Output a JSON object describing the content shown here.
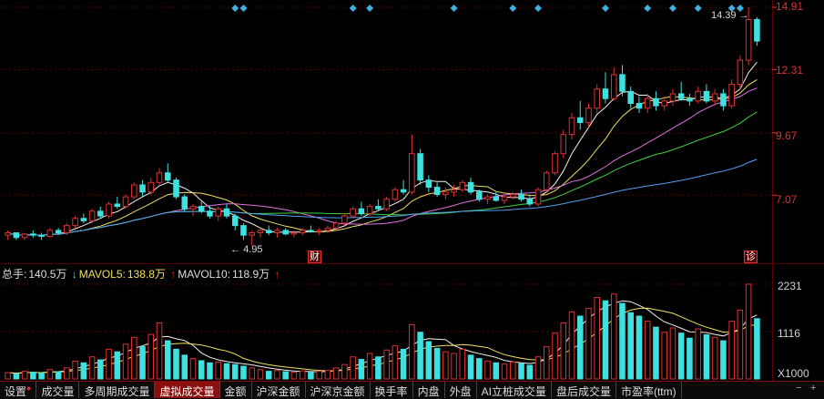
{
  "price_axis": {
    "labels": [
      "14.91",
      "12.31",
      "9.67",
      "7.07"
    ]
  },
  "volume_axis": {
    "labels": [
      "2231",
      "1116",
      "X1000"
    ]
  },
  "annotations": {
    "high": "14.39",
    "low": "4.95",
    "event_cai": "财",
    "event_zhen": "诊"
  },
  "indicators": {
    "total_label": "总手:",
    "total_value": "140.5万",
    "mavol5_label": "MAVOL5:",
    "mavol5_value": "138.8万",
    "mavol10_label": "MAVOL10:",
    "mavol10_value": "118.9万"
  },
  "tabs": [
    {
      "label": "设置",
      "active": false,
      "dot": true
    },
    {
      "label": "成交量",
      "active": false
    },
    {
      "label": "多周期成交量",
      "active": false
    },
    {
      "label": "虚拟成交量",
      "active": true
    },
    {
      "label": "金额",
      "active": false
    },
    {
      "label": "沪深金额",
      "active": false
    },
    {
      "label": "沪深京金额",
      "active": false
    },
    {
      "label": "换手率",
      "active": false
    },
    {
      "label": "内盘",
      "active": false
    },
    {
      "label": "外盘",
      "active": false
    },
    {
      "label": "AI立桩成交量",
      "active": false
    },
    {
      "label": "盘后成交量",
      "active": false
    },
    {
      "label": "市盈率(ttm)",
      "active": false
    }
  ],
  "controls": {
    "minus": "−",
    "plus": "+"
  },
  "colors": {
    "up": "#e03030",
    "down": "#3fe0e0",
    "ma_white": "#f0f0f0",
    "ma_yellow": "#f0e060",
    "ma_pink": "#e070e0",
    "ma_green": "#40d040",
    "ma_blue": "#50a0f0",
    "grid": "#5a0000"
  },
  "chart_data": {
    "type": "candlestick",
    "price_range": [
      4.95,
      14.91
    ],
    "volume_range": [
      0,
      2231
    ],
    "volume_unit": "X1000",
    "candles": [
      [
        5.4,
        5.6,
        5.2,
        5.5
      ],
      [
        5.5,
        5.5,
        5.2,
        5.3
      ],
      [
        5.3,
        5.5,
        5.2,
        5.45
      ],
      [
        5.45,
        5.6,
        5.3,
        5.4
      ],
      [
        5.4,
        5.5,
        5.2,
        5.35
      ],
      [
        5.35,
        5.7,
        5.3,
        5.6
      ],
      [
        5.6,
        5.7,
        5.4,
        5.5
      ],
      [
        5.5,
        5.9,
        5.4,
        5.8
      ],
      [
        5.8,
        6.2,
        5.7,
        6.1
      ],
      [
        6.1,
        6.3,
        5.9,
        6.0
      ],
      [
        6.0,
        6.5,
        5.9,
        6.4
      ],
      [
        6.4,
        6.6,
        6.1,
        6.2
      ],
      [
        6.2,
        6.8,
        6.1,
        6.7
      ],
      [
        6.7,
        7.0,
        6.5,
        6.6
      ],
      [
        6.6,
        7.1,
        6.5,
        7.0
      ],
      [
        7.0,
        7.6,
        6.9,
        7.5
      ],
      [
        7.5,
        7.7,
        7.0,
        7.2
      ],
      [
        7.2,
        7.8,
        7.1,
        7.6
      ],
      [
        7.6,
        8.2,
        7.5,
        8.0
      ],
      [
        8.0,
        8.4,
        7.6,
        7.7
      ],
      [
        7.7,
        7.8,
        6.9,
        7.0
      ],
      [
        7.0,
        7.1,
        6.4,
        6.5
      ],
      [
        6.5,
        6.7,
        6.2,
        6.6
      ],
      [
        6.6,
        6.8,
        6.3,
        6.4
      ],
      [
        6.4,
        6.6,
        6.1,
        6.2
      ],
      [
        6.2,
        6.6,
        6.0,
        6.5
      ],
      [
        6.5,
        6.7,
        6.1,
        6.2
      ],
      [
        6.2,
        6.3,
        5.6,
        5.8
      ],
      [
        5.8,
        5.9,
        5.2,
        5.4
      ],
      [
        5.4,
        5.6,
        4.95,
        5.5
      ],
      [
        5.5,
        5.7,
        5.3,
        5.6
      ],
      [
        5.6,
        5.8,
        5.4,
        5.5
      ],
      [
        5.5,
        5.7,
        5.3,
        5.6
      ],
      [
        5.6,
        5.7,
        5.4,
        5.45
      ],
      [
        5.45,
        5.6,
        5.3,
        5.5
      ],
      [
        5.5,
        5.7,
        5.4,
        5.6
      ],
      [
        5.6,
        5.8,
        5.5,
        5.55
      ],
      [
        5.55,
        5.7,
        5.4,
        5.6
      ],
      [
        5.6,
        5.8,
        5.5,
        5.7
      ],
      [
        5.7,
        6.0,
        5.6,
        5.9
      ],
      [
        5.9,
        6.3,
        5.8,
        6.2
      ],
      [
        6.2,
        6.6,
        6.1,
        6.5
      ],
      [
        6.5,
        6.8,
        6.2,
        6.3
      ],
      [
        6.3,
        6.7,
        6.2,
        6.6
      ],
      [
        6.6,
        6.9,
        6.4,
        6.5
      ],
      [
        6.5,
        7.0,
        6.4,
        6.9
      ],
      [
        6.9,
        7.4,
        6.8,
        7.3
      ],
      [
        7.3,
        7.7,
        7.1,
        7.2
      ],
      [
        7.2,
        9.6,
        7.1,
        8.8
      ],
      [
        8.8,
        9.0,
        7.5,
        7.7
      ],
      [
        7.7,
        7.9,
        7.2,
        7.4
      ],
      [
        7.4,
        7.6,
        7.0,
        7.1
      ],
      [
        7.1,
        7.4,
        6.9,
        7.2
      ],
      [
        7.2,
        7.5,
        7.0,
        7.3
      ],
      [
        7.3,
        7.7,
        7.2,
        7.6
      ],
      [
        7.6,
        7.8,
        7.1,
        7.2
      ],
      [
        7.2,
        7.3,
        6.8,
        6.9
      ],
      [
        6.9,
        7.1,
        6.7,
        7.0
      ],
      [
        7.0,
        7.2,
        6.8,
        6.85
      ],
      [
        6.85,
        7.1,
        6.7,
        7.0
      ],
      [
        7.0,
        7.2,
        6.9,
        7.1
      ],
      [
        7.1,
        7.3,
        6.8,
        6.9
      ],
      [
        6.9,
        7.1,
        6.6,
        6.7
      ],
      [
        6.7,
        7.4,
        6.6,
        7.3
      ],
      [
        7.3,
        8.1,
        7.2,
        8.0
      ],
      [
        8.0,
        8.9,
        7.9,
        8.8
      ],
      [
        8.8,
        9.8,
        8.6,
        9.6
      ],
      [
        9.6,
        10.5,
        9.4,
        10.3
      ],
      [
        10.3,
        11.0,
        9.8,
        10.1
      ],
      [
        10.1,
        10.9,
        9.9,
        10.7
      ],
      [
        10.7,
        11.7,
        10.5,
        11.5
      ],
      [
        11.5,
        12.2,
        10.9,
        11.1
      ],
      [
        11.1,
        12.4,
        11.0,
        12.1
      ],
      [
        12.1,
        12.5,
        11.2,
        11.4
      ],
      [
        11.4,
        11.6,
        10.7,
        10.9
      ],
      [
        10.9,
        11.2,
        10.5,
        10.7
      ],
      [
        10.7,
        11.3,
        10.5,
        11.1
      ],
      [
        11.1,
        11.4,
        10.6,
        10.8
      ],
      [
        10.8,
        11.2,
        10.6,
        11.0
      ],
      [
        11.0,
        11.5,
        10.8,
        11.3
      ],
      [
        11.3,
        11.8,
        11.0,
        11.1
      ],
      [
        11.1,
        11.3,
        10.8,
        11.0
      ],
      [
        11.0,
        11.6,
        10.9,
        11.4
      ],
      [
        11.4,
        11.7,
        10.9,
        11.0
      ],
      [
        11.0,
        11.5,
        10.8,
        11.3
      ],
      [
        11.3,
        11.5,
        10.6,
        10.8
      ],
      [
        10.8,
        11.9,
        10.7,
        11.7
      ],
      [
        11.7,
        12.9,
        11.5,
        12.7
      ],
      [
        12.7,
        14.91,
        12.5,
        14.4
      ],
      [
        14.4,
        14.5,
        13.3,
        13.5
      ]
    ],
    "volumes": [
      150,
      120,
      180,
      160,
      140,
      220,
      170,
      260,
      420,
      380,
      520,
      450,
      700,
      640,
      820,
      980,
      760,
      1050,
      1320,
      900,
      700,
      560,
      480,
      430,
      380,
      400,
      360,
      340,
      300,
      260,
      220,
      180,
      200,
      170,
      160,
      190,
      150,
      180,
      200,
      260,
      340,
      520,
      460,
      600,
      520,
      680,
      780,
      700,
      1280,
      1100,
      880,
      720,
      640,
      600,
      700,
      560,
      480,
      420,
      380,
      350,
      400,
      360,
      320,
      520,
      760,
      1080,
      1320,
      1580,
      1480,
      1660,
      1920,
      1840,
      2000,
      1780,
      1560,
      1480,
      1360,
      1220,
      1100,
      1200,
      1080,
      960,
      1180,
      1040,
      980,
      900,
      1360,
      1620,
      2231,
      1420
    ]
  }
}
